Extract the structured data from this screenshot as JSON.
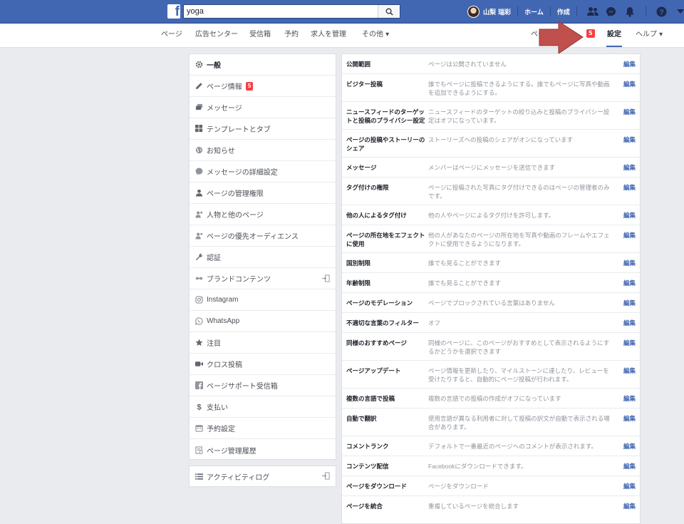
{
  "topbar": {
    "logo": "f",
    "search_value": "yoga",
    "user_name": "山梨 瑞彩",
    "home_label": "ホーム",
    "create_label": "作成"
  },
  "nav": {
    "items": [
      "ページ",
      "広告センター",
      "受信箱",
      "予約",
      "求人を管理",
      "その他 ▾"
    ],
    "page_label": "ペー",
    "badge": "5",
    "settings_label": "設定",
    "help_label": "ヘルプ ▾"
  },
  "sidebar": {
    "items": [
      {
        "label": "一般",
        "icon": "gear-icon"
      },
      {
        "label": "ページ情報",
        "icon": "pencil-icon",
        "badge": "5"
      },
      {
        "label": "メッセージ",
        "icon": "chat-icon"
      },
      {
        "label": "テンプレートとタブ",
        "icon": "grid-icon"
      },
      {
        "label": "お知らせ",
        "icon": "globe-icon"
      },
      {
        "label": "メッセージの詳細設定",
        "icon": "messenger-icon"
      },
      {
        "label": "ページの管理権限",
        "icon": "person-icon"
      },
      {
        "label": "人物と他のページ",
        "icon": "people-icon"
      },
      {
        "label": "ページの優先オーディエンス",
        "icon": "people-icon"
      },
      {
        "label": "認証",
        "icon": "wrench-icon"
      },
      {
        "label": "ブランドコンテンツ",
        "icon": "handshake-icon"
      },
      {
        "label": "Instagram",
        "icon": "instagram-icon"
      },
      {
        "label": "WhatsApp",
        "icon": "whatsapp-icon"
      },
      {
        "label": "注目",
        "icon": "star-icon"
      },
      {
        "label": "クロス投稿",
        "icon": "video-icon"
      },
      {
        "label": "ページサポート受信箱",
        "icon": "facebook-icon"
      },
      {
        "label": "支払い",
        "icon": "dollar-icon"
      },
      {
        "label": "予約設定",
        "icon": "calendar-icon"
      },
      {
        "label": "ページ管理履歴",
        "icon": "history-icon"
      }
    ],
    "activity_log": "アクティビティログ"
  },
  "settings": [
    {
      "label": "公開範囲",
      "value": "ページは公開されていません"
    },
    {
      "label": "ビジター投稿",
      "value": "誰でもページに投稿できるようにする。誰でもページに写真や動画を追加できるようにする。"
    },
    {
      "label": "ニュースフィードのターゲットと投稿のプライバシー設定",
      "value": "ニュースフィードのターゲットの絞り込みと投稿のプライバシー設定はオフになっています。"
    },
    {
      "label": "ページの投稿やストーリーのシェア",
      "value": "ストーリーズへの投稿のシェアがオンになっています"
    },
    {
      "label": "メッセージ",
      "value": "メンバーはページにメッセージを送信できます"
    },
    {
      "label": "タグ付けの権限",
      "value": "ページに投稿された写真にタグ付けできるのはページの管理者のみです。"
    },
    {
      "label": "他の人によるタグ付け",
      "value": "他の人やページによるタグ付けを許可します。"
    },
    {
      "label": "ページの所在地をエフェクトに使用",
      "value": "他の人があなたのページの所在地を写真や動画のフレームやエフェクトに使用できるようになります。"
    },
    {
      "label": "国別制限",
      "value": "誰でも見ることができます"
    },
    {
      "label": "年齢制限",
      "value": "誰でも見ることができます"
    },
    {
      "label": "ページのモデレーション",
      "value": "ページでブロックされている言葉はありません"
    },
    {
      "label": "不適切な言葉のフィルター",
      "value": "オフ"
    },
    {
      "label": "同様のおすすめページ",
      "value": "同様のページに、このページがおすすめとして表示されるようにするかどうかを選択できます"
    },
    {
      "label": "ページアップデート",
      "value": "ページ情報を更新したり、マイルストーンに達したり、レビューを受けたりすると、自動的にページ投稿が行われます。"
    },
    {
      "label": "複数の言語で投稿",
      "value": "複数の言語での投稿の作成がオフになっています"
    },
    {
      "label": "自動で翻訳",
      "value": "使用言語が異なる利用者に対して投稿の訳文が自動で表示される場合があります。"
    },
    {
      "label": "コメントランク",
      "value": "デフォルトで一番最近のページへのコメントが表示されます。"
    },
    {
      "label": "コンテンツ配信",
      "value": "Facebookにダウンロードできます。"
    },
    {
      "label": "ページをダウンロード",
      "value": "ページをダウンロード"
    },
    {
      "label": "ページを統合",
      "value": "重複しているページを統合します"
    }
  ],
  "edit_label": "編集",
  "colors": {
    "brand_blue": "#4267b2",
    "badge_red": "#fa3e3e",
    "arrow_red": "#c0504d"
  }
}
